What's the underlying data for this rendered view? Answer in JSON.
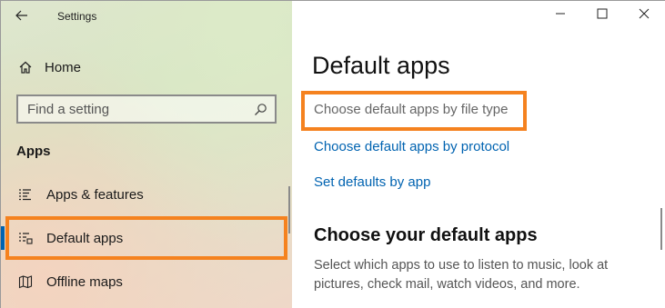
{
  "window": {
    "title": "Settings",
    "controls": [
      "minimize-icon",
      "maximize-icon",
      "close-icon"
    ]
  },
  "sidebar": {
    "back_icon": "arrow-left-icon",
    "home_label": "Home",
    "search_placeholder": "Find a setting",
    "section_header": "Apps",
    "items": [
      {
        "label": "Apps & features",
        "icon": "list-icon"
      },
      {
        "label": "Default apps",
        "icon": "default-apps-icon",
        "selected": true
      },
      {
        "label": "Offline maps",
        "icon": "map-icon"
      }
    ]
  },
  "main": {
    "page_title": "Default apps",
    "links": [
      {
        "label": "Choose default apps by file type"
      },
      {
        "label": "Choose default apps by protocol"
      },
      {
        "label": "Set defaults by app"
      }
    ],
    "subsection_title": "Choose your default apps",
    "description": "Select which apps to use to listen to music, look at pictures, check mail, watch videos, and more."
  },
  "colors": {
    "accent": "#0063b1",
    "highlight": "#f5821f"
  }
}
